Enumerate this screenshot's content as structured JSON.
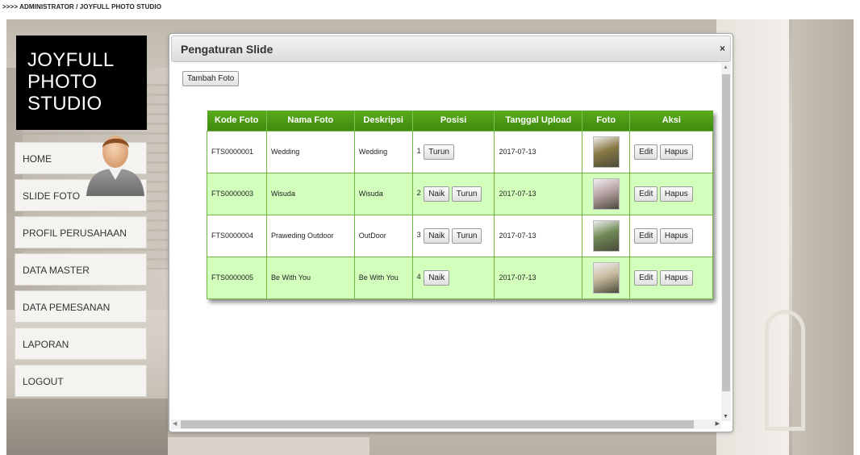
{
  "breadcrumb": ">>>> ADMINISTRATOR / JOYFULL PHOTO STUDIO",
  "logo": {
    "lines": [
      "JOYFULL",
      "PHOTO",
      "STUDIO"
    ]
  },
  "nav": {
    "items": [
      {
        "label": "HOME"
      },
      {
        "label": "SLIDE FOTO"
      },
      {
        "label": "PROFIL PERUSAHAAN"
      },
      {
        "label": "DATA MASTER"
      },
      {
        "label": "DATA PEMESANAN"
      },
      {
        "label": "LAPORAN"
      },
      {
        "label": "LOGOUT"
      }
    ]
  },
  "dialog": {
    "title": "Pengaturan Slide",
    "close": "×",
    "add_button": "Tambah Foto",
    "columns": [
      "Kode Foto",
      "Nama Foto",
      "Deskripsi",
      "Posisi",
      "Tanggal Upload",
      "Foto",
      "Aksi"
    ],
    "rows": [
      {
        "kode": "FTS0000001",
        "nama": "Wedding",
        "deskripsi": "Wedding",
        "posisi": "1",
        "naik": "",
        "turun": "Turun",
        "tanggal": "2017-07-13",
        "thumb_color": "#8a7a45",
        "edit": "Edit",
        "hapus": "Hapus"
      },
      {
        "kode": "FTS0000003",
        "nama": "Wisuda",
        "deskripsi": "Wisuda",
        "posisi": "2",
        "naik": "Naik",
        "turun": "Turun",
        "tanggal": "2017-07-13",
        "thumb_color": "#b9a3a6",
        "edit": "Edit",
        "hapus": "Hapus"
      },
      {
        "kode": "FTS0000004",
        "nama": "Praweding Outdoor",
        "deskripsi": "OutDoor",
        "posisi": "3",
        "naik": "Naik",
        "turun": "Turun",
        "tanggal": "2017-07-13",
        "thumb_color": "#6f8a56",
        "edit": "Edit",
        "hapus": "Hapus"
      },
      {
        "kode": "FTS0000005",
        "nama": "Be With You",
        "deskripsi": "Be With You",
        "posisi": "4",
        "naik": "Naik",
        "turun": "",
        "tanggal": "2017-07-13",
        "thumb_color": "#c9bca0",
        "edit": "Edit",
        "hapus": "Hapus"
      }
    ]
  },
  "colors": {
    "header_green": "#4c9a15",
    "row_green": "#d3ffbd",
    "logo_bg": "#000000"
  }
}
